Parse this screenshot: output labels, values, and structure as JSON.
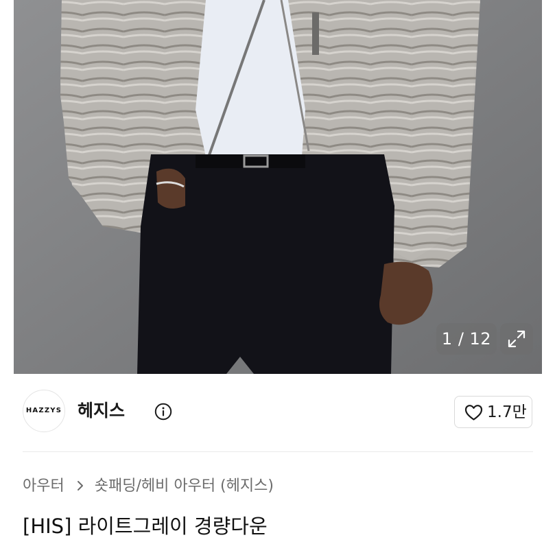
{
  "gallery": {
    "counter": "1 / 12",
    "expand_icon": "expand-arrows-icon"
  },
  "brand": {
    "logo_text": "HAZZYS",
    "name": "헤지스",
    "info_icon": "info-circle-icon"
  },
  "like": {
    "icon": "heart-outline-icon",
    "count": "1.7만"
  },
  "breadcrumb": {
    "items": [
      "아우터",
      "숏패딩/헤비 아우터 (헤지스)"
    ],
    "separator_icon": "chevron-right-icon"
  },
  "product": {
    "title": "[HIS] 라이트그레이 경량다운"
  },
  "colors": {
    "text_primary": "#111111",
    "text_secondary": "#6b6b6b",
    "border": "#d9d9d9",
    "divider": "#e9e9e9",
    "overlay": "#6e6e6e"
  }
}
